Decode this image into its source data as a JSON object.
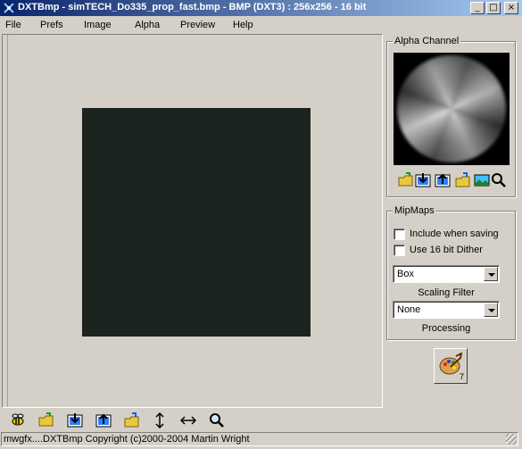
{
  "window": {
    "title": "DXTBmp - simTECH_Do335_prop_fast.bmp - BMP (DXT3) : 256x256 - 16 bit",
    "controls": {
      "minimize": "_",
      "maximize": "□",
      "close": "×"
    }
  },
  "menu": [
    "File",
    "Prefs",
    "Image",
    "Alpha",
    "Preview",
    "Help"
  ],
  "alpha_panel": {
    "title": "Alpha Channel",
    "icons": [
      "open-folder-icon",
      "import-icon",
      "export-icon",
      "save-folder-icon",
      "image-icon",
      "zoom-icon"
    ]
  },
  "mipmaps": {
    "title": "MipMaps",
    "include_when_saving": {
      "label": "Include when saving",
      "checked": false
    },
    "use_16bit_dither": {
      "label": "Use 16 bit Dither",
      "checked": false
    },
    "scaling_filter": {
      "value": "Box",
      "caption": "Scaling Filter"
    },
    "processing": {
      "value": "None",
      "caption": "Processing"
    }
  },
  "paint_button": {
    "badge": "7"
  },
  "toolbar": [
    "bee-icon",
    "open-folder-icon",
    "import-icon",
    "export-icon",
    "save-folder-icon",
    "resize-vertical-icon",
    "resize-horizontal-icon",
    "zoom-icon"
  ],
  "image_preview": {
    "color": "#1c2420"
  },
  "status": {
    "text": "mwgfx....DXTBmp Copyright (c)2000-2004 Martin Wright"
  }
}
